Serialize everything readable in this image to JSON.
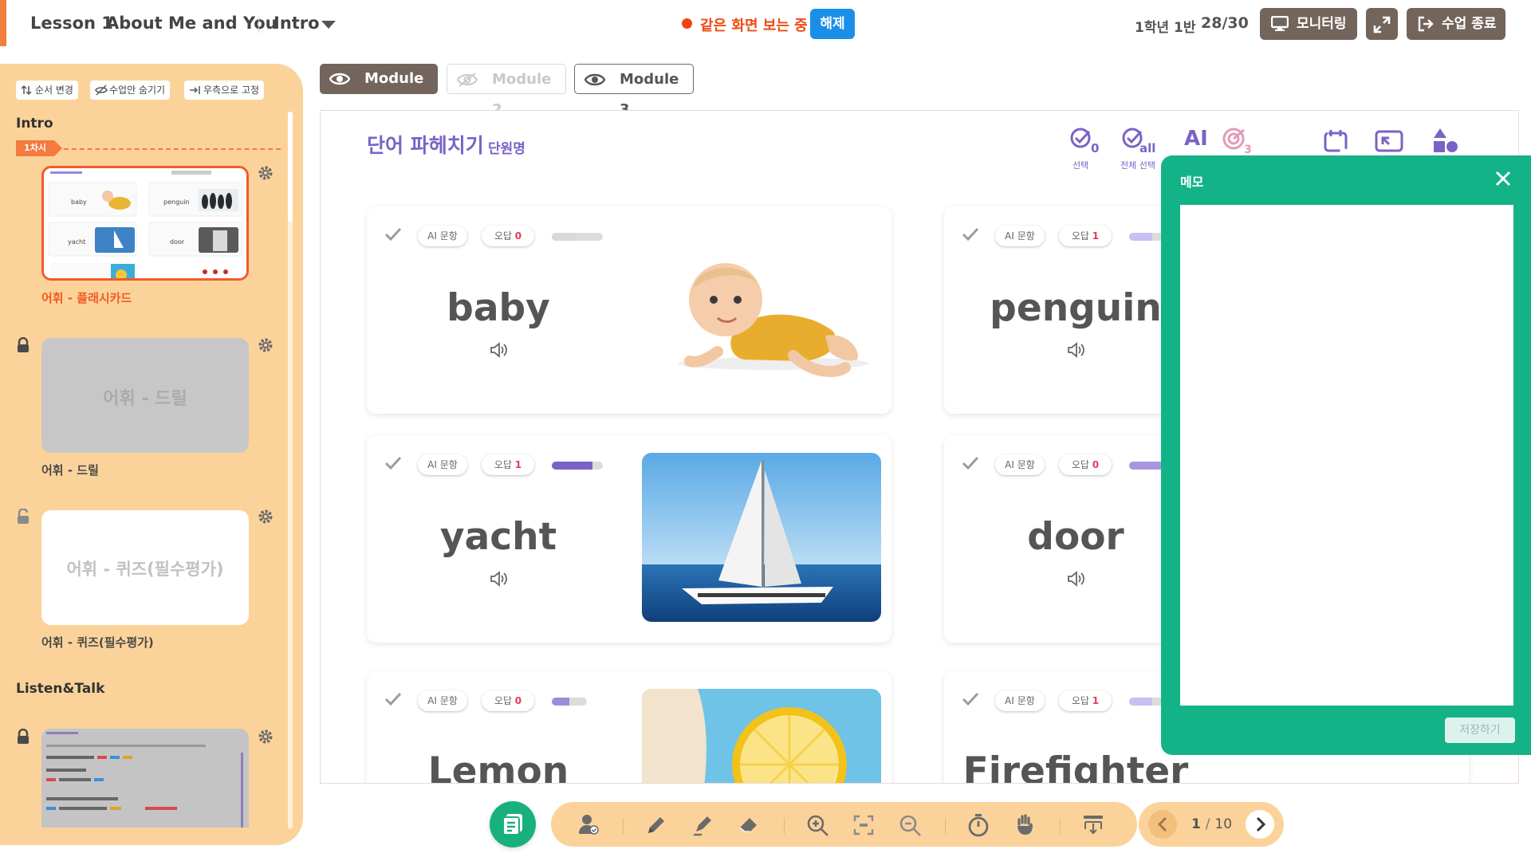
{
  "header": {
    "lesson": "Lesson 1",
    "title": "About Me and You",
    "section": "Intro",
    "live_status": "같은 화면 보는 중",
    "release_label": "해제",
    "class_info": "1학년 1반",
    "class_count": "28/30",
    "monitoring_label": "모니터링",
    "end_class_label": "수업 종료"
  },
  "sidebar": {
    "toolbar": [
      "순서 변경",
      "수업안 숨기기",
      "우측으로 고정"
    ],
    "sections": [
      {
        "title": "Intro",
        "session_tag": "1차시",
        "items": [
          {
            "label": "어휘 - 플래시카드",
            "overlay": "",
            "state": "active"
          },
          {
            "label": "어휘 - 드릴",
            "overlay": "어휘 - 드릴",
            "state": "locked"
          },
          {
            "label": "어휘 - 퀴즈(필수평가)",
            "overlay": "어휘 - 퀴즈(필수평가)",
            "state": "unlocked"
          }
        ]
      },
      {
        "title": "Listen&Talk"
      }
    ]
  },
  "modules": [
    {
      "label": "Module 1",
      "state": "active"
    },
    {
      "label": "Module 2",
      "state": "hidden"
    },
    {
      "label": "Module 3",
      "state": "normal"
    }
  ],
  "board": {
    "title": "단어 파헤치기",
    "subtitle": "단원명",
    "tools": [
      {
        "icon": "check-select-icon",
        "caption": "선택"
      },
      {
        "icon": "check-all-icon",
        "caption": "전체 선택"
      },
      {
        "icon": "ai-icon",
        "caption": ""
      },
      {
        "icon": "target-icon",
        "caption": ""
      },
      {
        "icon": "refresh-icon",
        "caption": ""
      },
      {
        "icon": "cast-icon",
        "caption": ""
      },
      {
        "icon": "shapes-icon",
        "caption": ""
      }
    ],
    "tool_ai": "AI",
    "pill_ai": "AI 문항",
    "pill_wrong": "오답",
    "cards": [
      {
        "word": "baby",
        "wrong": 0,
        "progress": 0.45
      },
      {
        "word": "penguin",
        "wrong": 1,
        "progress": 0.45
      },
      {
        "word": "yacht",
        "wrong": 1,
        "progress": 0.8
      },
      {
        "word": "door",
        "wrong": 0,
        "progress": 0.65
      },
      {
        "word": "Lemon",
        "wrong": 0,
        "progress": 0.5
      },
      {
        "word": "Firefighter",
        "wrong": 1,
        "progress": 0.45
      }
    ]
  },
  "memo": {
    "title": "메모",
    "save_label": "저장하기"
  },
  "pager": {
    "current": "1",
    "separator": "/",
    "total": "10"
  },
  "colors": {
    "accent": "#f27f3d",
    "sidebar_bg": "#fbd39a",
    "purple": "#7a63c6",
    "memo_green": "#14b387",
    "live_red": "#ef4a12",
    "release_blue": "#1a8fe8"
  }
}
